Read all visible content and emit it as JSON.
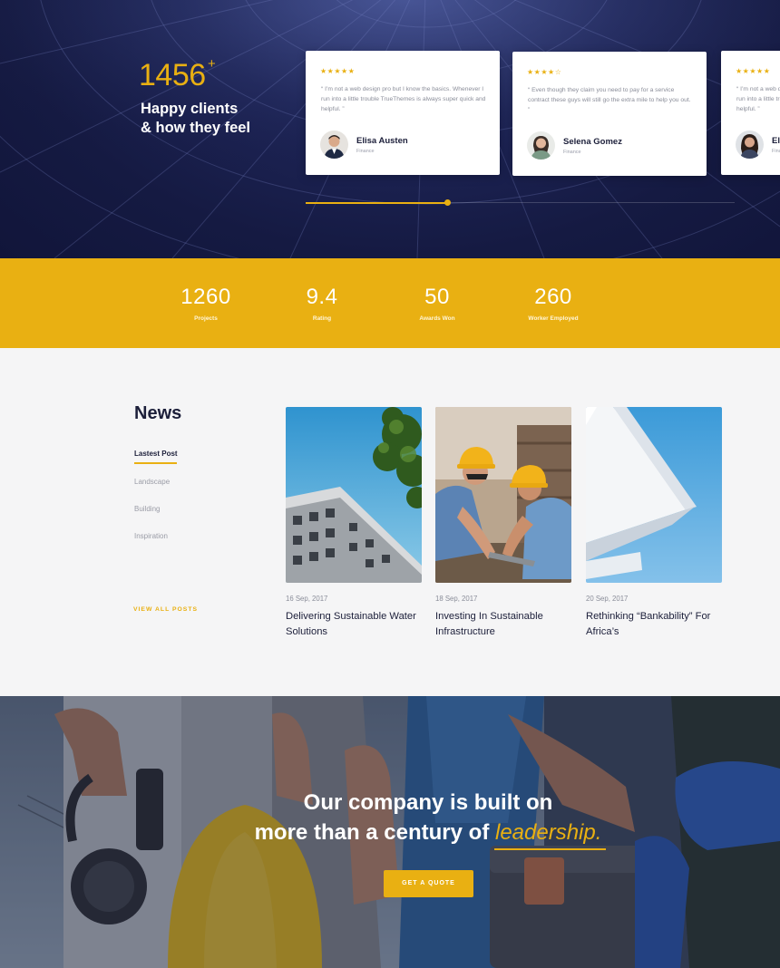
{
  "testimonials": {
    "counter": "1456",
    "counter_sup": "+",
    "heading_line1": "Happy clients",
    "heading_line2": "& how they feel",
    "cards": [
      {
        "stars": "★★★★★",
        "quote": "“ I’m not a web design pro but I know the basics. Whenever I run into a little trouble TrueThemes is always super quick and helpful. ”",
        "name": "Elisa Austen",
        "role": "Finance"
      },
      {
        "stars": "★★★★☆",
        "quote": "“ Even though they claim you need to pay for a service contract these guys will still go the extra mile to help you out. ”",
        "name": "Selena Gomez",
        "role": "Finance"
      },
      {
        "stars": "★★★★★",
        "quote": "“ I’m not a web design pro but I know the basics. Whenever I run into a little trouble TrueThemes is always super quick and helpful. ”",
        "name": "Elisa Austen",
        "role": "Finance"
      }
    ],
    "slider_progress": 0.33
  },
  "stats": [
    {
      "value": "1260",
      "label": "Projects"
    },
    {
      "value": "9.4",
      "label": "Rating"
    },
    {
      "value": "50",
      "label": "Awards Won"
    },
    {
      "value": "260",
      "label": "Worker Employed"
    }
  ],
  "news": {
    "title": "News",
    "categories": [
      "Lastest Post",
      "Landscape",
      "Building",
      "Inspiration"
    ],
    "view_all": "VIEW ALL POSTS",
    "posts": [
      {
        "date": "16 Sep, 2017",
        "title": "Delivering Sustainable Water Solutions"
      },
      {
        "date": "18 Sep, 2017",
        "title": "Investing In Sustainable Infrastructure"
      },
      {
        "date": "20 Sep, 2017",
        "title": "Rethinking “Bankability” For Africa’s"
      }
    ]
  },
  "cta": {
    "line1": "Our company is built on",
    "line2_prefix": "more than a century of ",
    "line2_highlight": "leadership.",
    "button": "GET A QUOTE"
  },
  "colors": {
    "accent": "#e9b012",
    "navy": "#151a42",
    "text_dark": "#1c1f3a",
    "background": "#f5f5f6"
  }
}
